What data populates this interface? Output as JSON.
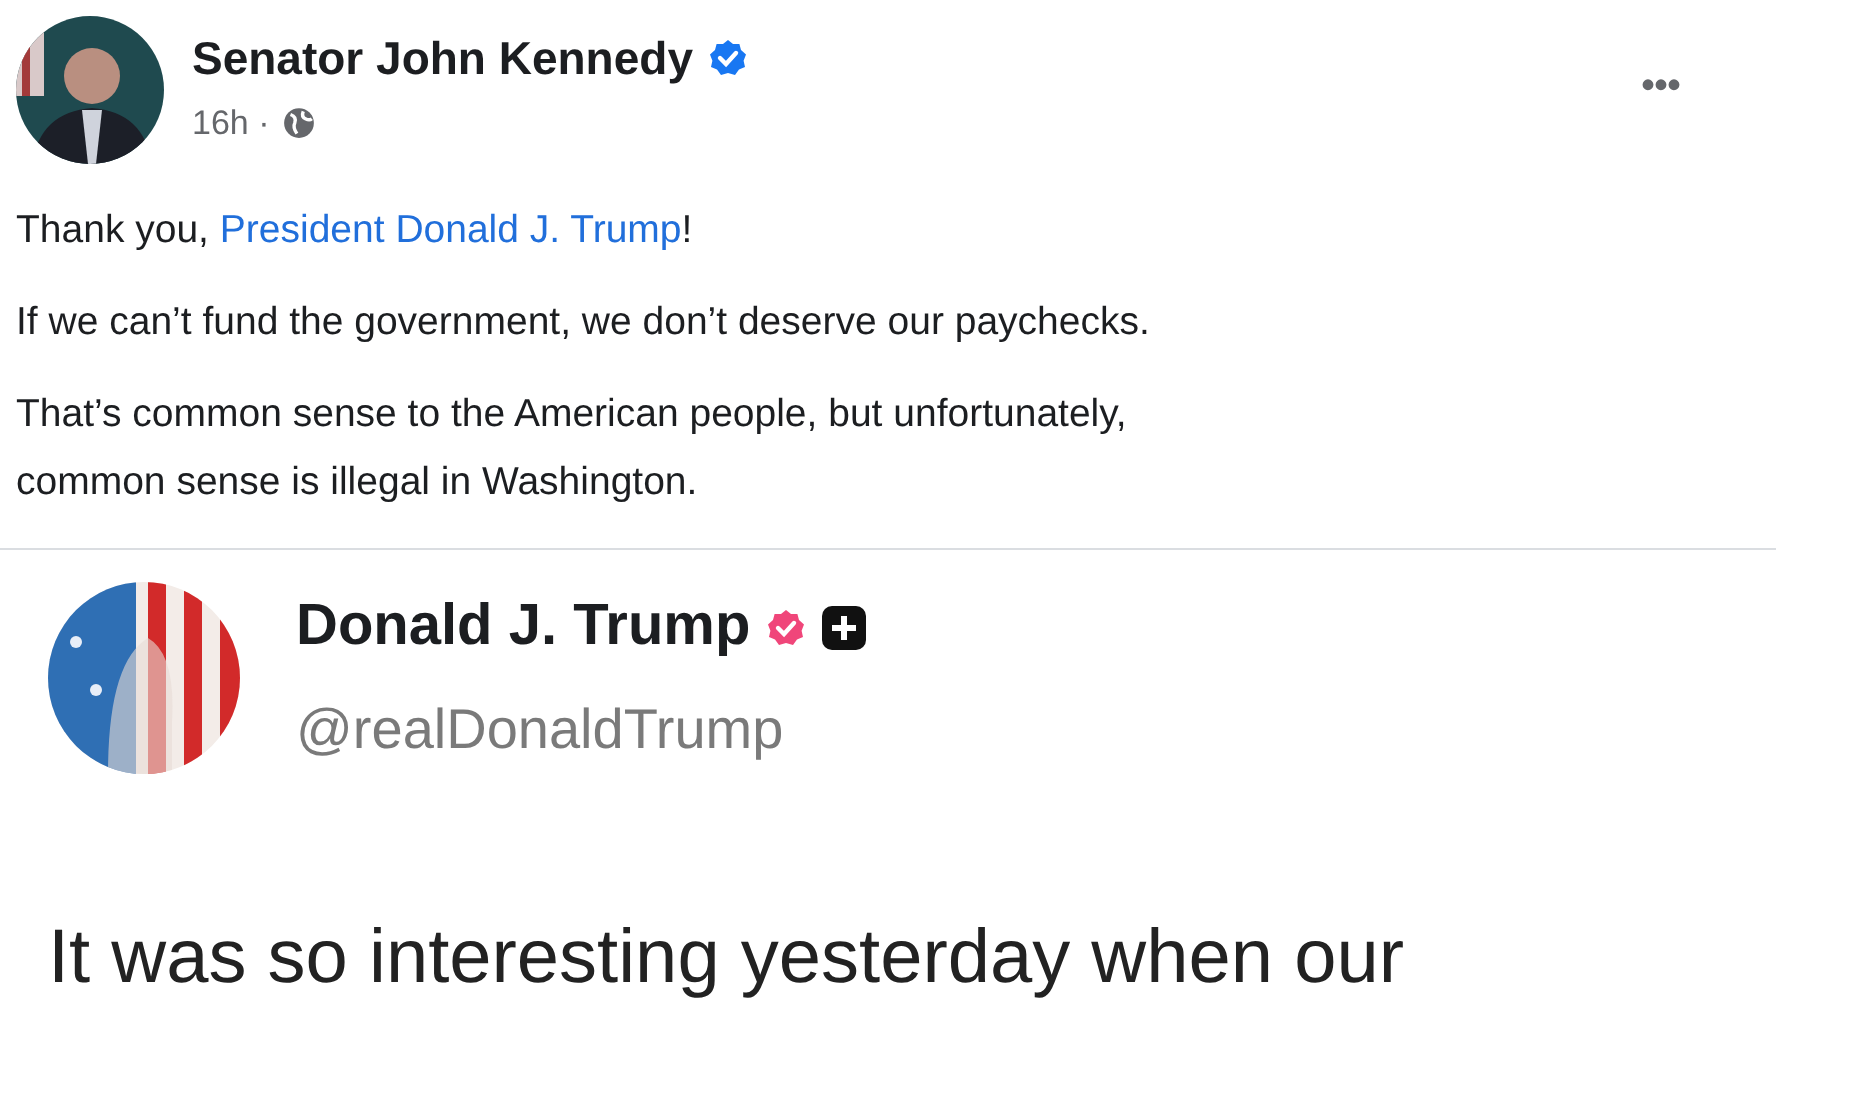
{
  "post": {
    "author": "Senator John Kennedy",
    "verified": true,
    "time": "16h ·",
    "more": "•••",
    "paragraphs": [
      {
        "parts": [
          {
            "text": "Thank you, ",
            "link": false
          },
          {
            "text": "President Donald J. Trump",
            "link": true
          },
          {
            "text": "!",
            "link": false
          }
        ]
      },
      {
        "parts": [
          {
            "text": "If we can’t fund the government, we don’t deserve our paychecks.",
            "link": false
          }
        ]
      },
      {
        "parts": [
          {
            "text": "That’s common sense to the American people, but unfortunately, common sense is illegal in Washington.",
            "link": false
          }
        ]
      }
    ]
  },
  "shared_post": {
    "author": "Donald J. Trump",
    "verified": true,
    "handle": "@realDonaldTrump",
    "text": "It was so interesting yesterday when our"
  }
}
